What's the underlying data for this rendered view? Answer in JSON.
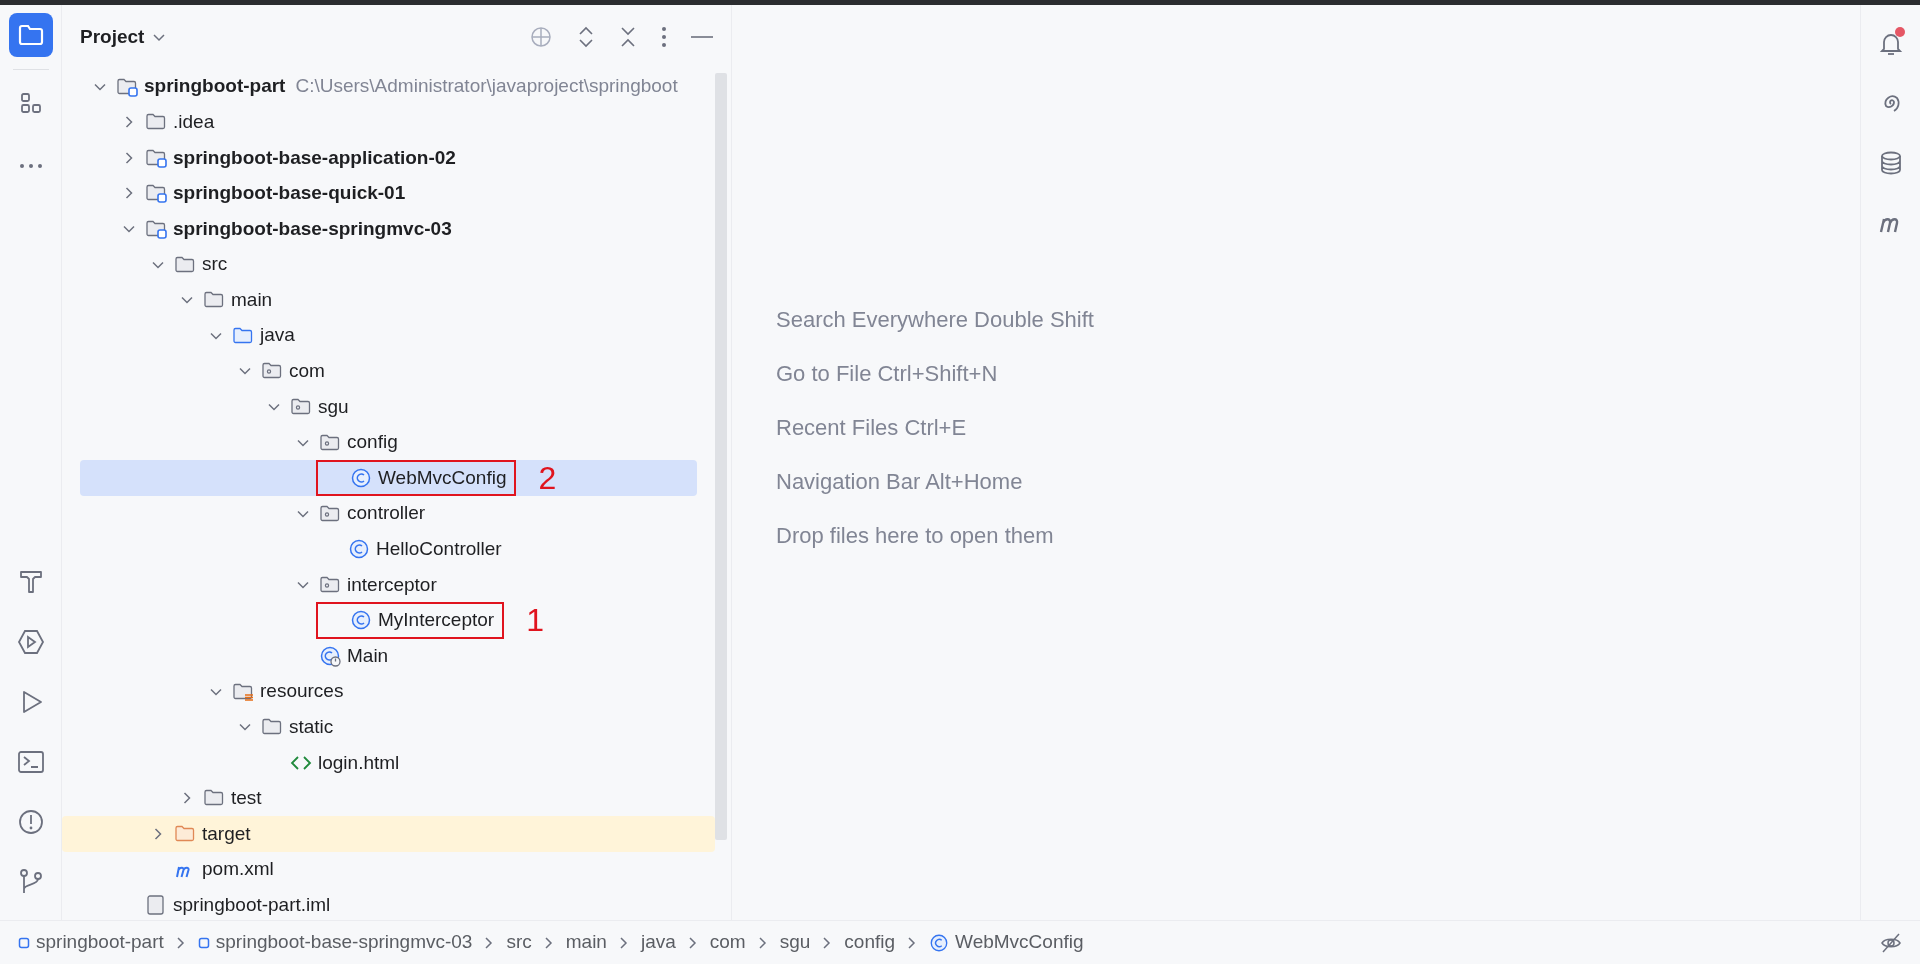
{
  "left_toolbar": {
    "top": [
      {
        "kind": "project",
        "selected": true
      },
      {
        "kind": "structure",
        "selected": false
      },
      {
        "kind": "more",
        "selected": false
      }
    ],
    "bottom": [
      {
        "kind": "build",
        "selected": false
      },
      {
        "kind": "services",
        "selected": false
      },
      {
        "kind": "run",
        "selected": false
      },
      {
        "kind": "terminal",
        "selected": false
      },
      {
        "kind": "problems",
        "selected": false
      },
      {
        "kind": "git",
        "selected": false
      }
    ]
  },
  "project_panel": {
    "title": "Project",
    "tree": [
      {
        "label": "springboot-part",
        "kind": "module",
        "path": "C:\\Users\\Administrator\\javaproject\\springboot",
        "expanded": true,
        "selected": false,
        "excluded": false,
        "children": [
          {
            "label": ".idea",
            "kind": "folder",
            "expanded": false,
            "selected": false,
            "excluded": false
          },
          {
            "label": "springboot-base-application-02",
            "kind": "module",
            "expanded": false,
            "selected": false,
            "excluded": false
          },
          {
            "label": "springboot-base-quick-01",
            "kind": "module",
            "expanded": false,
            "selected": false,
            "excluded": false
          },
          {
            "label": "springboot-base-springmvc-03",
            "kind": "module",
            "expanded": true,
            "selected": false,
            "excluded": false,
            "children": [
              {
                "label": "src",
                "kind": "folder",
                "expanded": true,
                "selected": false,
                "excluded": false,
                "children": [
                  {
                    "label": "main",
                    "kind": "folder",
                    "expanded": true,
                    "selected": false,
                    "excluded": false,
                    "children": [
                      {
                        "label": "java",
                        "kind": "source",
                        "expanded": true,
                        "selected": false,
                        "excluded": false,
                        "children": [
                          {
                            "label": "com",
                            "kind": "package",
                            "expanded": true,
                            "selected": false,
                            "excluded": false,
                            "children": [
                              {
                                "label": "sgu",
                                "kind": "package",
                                "expanded": true,
                                "selected": false,
                                "excluded": false,
                                "children": [
                                  {
                                    "label": "config",
                                    "kind": "package",
                                    "expanded": true,
                                    "selected": false,
                                    "excluded": false,
                                    "children": [
                                      {
                                        "label": "WebMvcConfig",
                                        "kind": "class",
                                        "selected": true,
                                        "excluded": false,
                                        "annotation": "2"
                                      }
                                    ]
                                  },
                                  {
                                    "label": "controller",
                                    "kind": "package",
                                    "expanded": true,
                                    "selected": false,
                                    "excluded": false,
                                    "children": [
                                      {
                                        "label": "HelloController",
                                        "kind": "class",
                                        "selected": false,
                                        "excluded": false
                                      }
                                    ]
                                  },
                                  {
                                    "label": "interceptor",
                                    "kind": "package",
                                    "expanded": true,
                                    "selected": false,
                                    "excluded": false,
                                    "children": [
                                      {
                                        "label": "MyInterceptor",
                                        "kind": "class",
                                        "selected": false,
                                        "excluded": false,
                                        "annotation": "1"
                                      }
                                    ]
                                  },
                                  {
                                    "label": "Main",
                                    "kind": "main-class",
                                    "selected": false,
                                    "excluded": false
                                  }
                                ]
                              }
                            ]
                          }
                        ]
                      },
                      {
                        "label": "resources",
                        "kind": "resources",
                        "expanded": true,
                        "selected": false,
                        "excluded": false,
                        "children": [
                          {
                            "label": "static",
                            "kind": "folder",
                            "expanded": true,
                            "selected": false,
                            "excluded": false,
                            "children": [
                              {
                                "label": "login.html",
                                "kind": "html",
                                "selected": false,
                                "excluded": false
                              }
                            ]
                          }
                        ]
                      }
                    ]
                  },
                  {
                    "label": "test",
                    "kind": "folder",
                    "expanded": false,
                    "selected": false,
                    "excluded": false
                  }
                ]
              },
              {
                "label": "target",
                "kind": "target-folder",
                "expanded": false,
                "selected": false,
                "excluded": true
              },
              {
                "label": "pom.xml",
                "kind": "maven",
                "selected": false,
                "excluded": false
              }
            ]
          },
          {
            "label": "springboot-part.iml",
            "kind": "file",
            "selected": false,
            "excluded": false
          }
        ]
      }
    ]
  },
  "editor_hints": [
    "Search Everywhere Double Shift",
    "Go to File Ctrl+Shift+N",
    "Recent Files Ctrl+E",
    "Navigation Bar Alt+Home",
    "Drop files here to open them"
  ],
  "right_toolbar": [
    {
      "kind": "notifications",
      "badge": true
    },
    {
      "kind": "ai",
      "badge": false
    },
    {
      "kind": "database",
      "badge": false
    },
    {
      "kind": "maven",
      "badge": false
    }
  ],
  "breadcrumbs": [
    {
      "label": "springboot-part",
      "kind": "module"
    },
    {
      "label": "springboot-base-springmvc-03",
      "kind": "module"
    },
    {
      "label": "src",
      "kind": "plain"
    },
    {
      "label": "main",
      "kind": "plain"
    },
    {
      "label": "java",
      "kind": "plain"
    },
    {
      "label": "com",
      "kind": "plain"
    },
    {
      "label": "sgu",
      "kind": "plain"
    },
    {
      "label": "config",
      "kind": "plain"
    },
    {
      "label": "WebMvcConfig",
      "kind": "class"
    }
  ]
}
